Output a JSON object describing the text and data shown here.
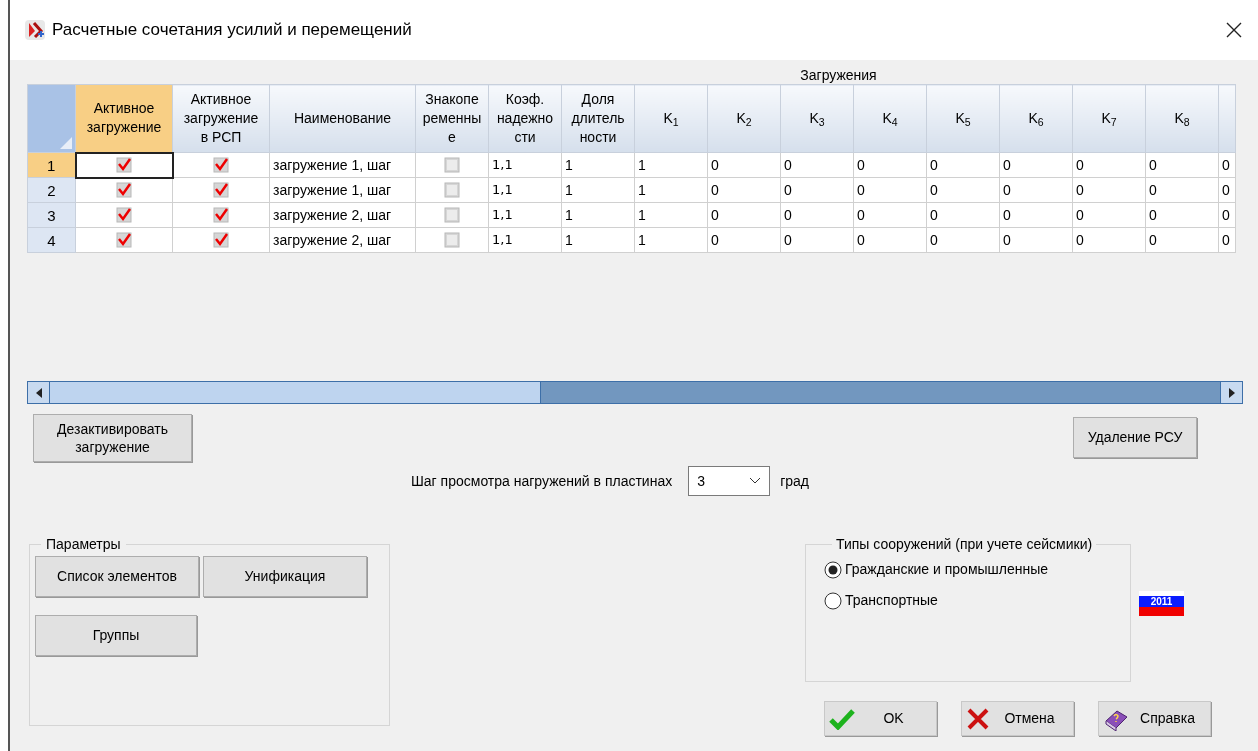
{
  "window": {
    "title": "Расчетные сочетания усилий и перемещений"
  },
  "table": {
    "group_header": "Загружения",
    "columns": [
      {
        "label": "Активное\nзагружение",
        "selected": true
      },
      {
        "label": "Активное\nзагружение\nв РСП",
        "selected": false
      },
      {
        "label": "Наименование",
        "selected": false
      },
      {
        "label": "Знакопе\nременны\nе",
        "selected": false
      },
      {
        "label": "Коэф.\nнадежно\nсти",
        "selected": false
      },
      {
        "label": "Доля\nдлитель\nности",
        "selected": false
      },
      {
        "label": "K$_{1}$",
        "selected": false
      },
      {
        "label": "K$_{2}$",
        "selected": false
      },
      {
        "label": "K$_{3}$",
        "selected": false
      },
      {
        "label": "K$_{4}$",
        "selected": false
      },
      {
        "label": "K$_{5}$",
        "selected": false
      },
      {
        "label": "K$_{6}$",
        "selected": false
      },
      {
        "label": "K$_{7}$",
        "selected": false
      },
      {
        "label": "K$_{8}$",
        "selected": false
      }
    ],
    "rows": [
      {
        "number": "1",
        "selected": true,
        "active": true,
        "active_in_rsp": true,
        "name": "загружение 1, шаг",
        "sign_variable": false,
        "reliability": "1,1",
        "duration": "1",
        "k": [
          "1",
          "0",
          "0",
          "0",
          "0",
          "0",
          "0",
          "0",
          "0"
        ]
      },
      {
        "number": "2",
        "selected": false,
        "active": true,
        "active_in_rsp": true,
        "name": "загружение 1, шаг",
        "sign_variable": false,
        "reliability": "1,1",
        "duration": "1",
        "k": [
          "1",
          "0",
          "0",
          "0",
          "0",
          "0",
          "0",
          "0",
          "0"
        ]
      },
      {
        "number": "3",
        "selected": false,
        "active": true,
        "active_in_rsp": true,
        "name": "загружение 2, шаг",
        "sign_variable": false,
        "reliability": "1,1",
        "duration": "1",
        "k": [
          "1",
          "0",
          "0",
          "0",
          "0",
          "0",
          "0",
          "0",
          "0"
        ]
      },
      {
        "number": "4",
        "selected": false,
        "active": true,
        "active_in_rsp": true,
        "name": "загружение 2, шаг",
        "sign_variable": false,
        "reliability": "1,1",
        "duration": "1",
        "k": [
          "1",
          "0",
          "0",
          "0",
          "0",
          "0",
          "0",
          "0",
          "0"
        ]
      }
    ]
  },
  "deactivate_button": "Дезактивировать\nзагружение",
  "delete_button": "Удаление РСУ",
  "step": {
    "label": "Шаг просмотра нагружений в пластинах",
    "value": "3",
    "unit": "град"
  },
  "parameters": {
    "title": "Параметры",
    "buttons": [
      "Список элементов",
      "Унификация",
      "Группы"
    ]
  },
  "structure_types": {
    "title": "Типы сооружений (при учете сейсмики)",
    "options": [
      {
        "label": "Гражданские и промышленные",
        "selected": true
      },
      {
        "label": "Транспортные",
        "selected": false
      }
    ]
  },
  "flag_badge": "2011",
  "dialog_buttons": [
    {
      "kind": "ok",
      "label": "OK"
    },
    {
      "kind": "cancel",
      "label": "Отмена"
    },
    {
      "kind": "help",
      "label": "Справка"
    }
  ]
}
